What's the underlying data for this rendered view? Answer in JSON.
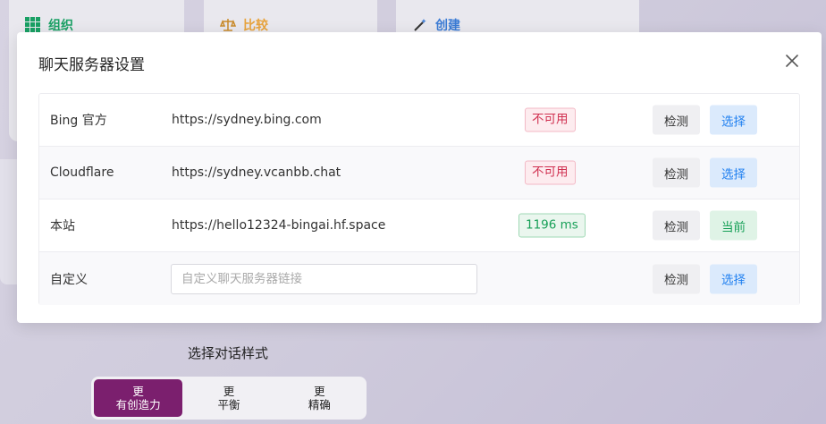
{
  "background": {
    "cards": [
      {
        "label": "组织",
        "icon": "grid-icon",
        "color": "#19a064"
      },
      {
        "label": "比较",
        "icon": "scale-icon",
        "color": "#e8a33c"
      },
      {
        "label": "创建",
        "icon": "magic-wand-icon",
        "color": "#3a7bd5"
      }
    ],
    "style_title": "选择对话样式",
    "styles": [
      {
        "line1": "更",
        "line2": "有创造力",
        "active": true
      },
      {
        "line1": "更",
        "line2": "平衡",
        "active": false
      },
      {
        "line1": "更",
        "line2": "精确",
        "active": false
      }
    ]
  },
  "modal": {
    "title": "聊天服务器设置",
    "rows": [
      {
        "name": "Bing 官方",
        "url": "https://sydney.bing.com",
        "status": "不可用",
        "check_label": "检测",
        "action_label": "选择"
      },
      {
        "name": "Cloudflare",
        "url": "https://sydney.vcanbb.chat",
        "status": "不可用",
        "check_label": "检测",
        "action_label": "选择"
      },
      {
        "name": "本站",
        "url": "https://hello12324-bingai.hf.space",
        "status": "1196 ms",
        "check_label": "检测",
        "action_label": "当前"
      },
      {
        "name": "自定义",
        "placeholder": "自定义聊天服务器链接",
        "value": "",
        "check_label": "检测",
        "action_label": "选择"
      }
    ]
  },
  "colors": {
    "error": "#d03050",
    "success": "#18a058",
    "primary": "#2080f0",
    "creative": "#7b1f6e"
  }
}
